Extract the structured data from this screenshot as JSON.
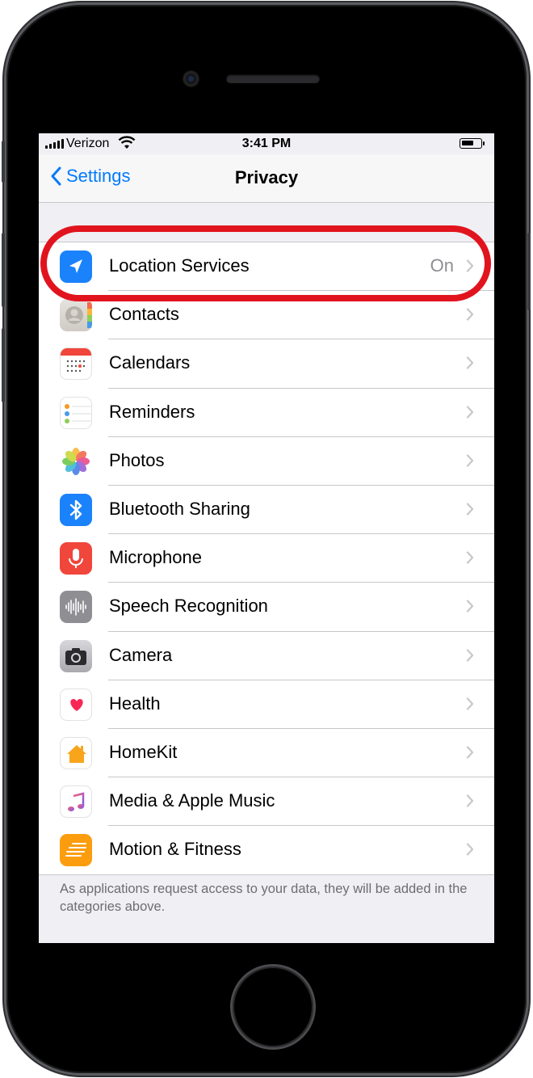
{
  "status_bar": {
    "carrier": "Verizon",
    "time": "3:41 PM"
  },
  "nav": {
    "back_label": "Settings",
    "title": "Privacy"
  },
  "rows": [
    {
      "label": "Location Services",
      "value": "On",
      "icon": "location-arrow-icon"
    },
    {
      "label": "Contacts",
      "icon": "contacts-icon"
    },
    {
      "label": "Calendars",
      "icon": "calendar-icon"
    },
    {
      "label": "Reminders",
      "icon": "reminders-icon"
    },
    {
      "label": "Photos",
      "icon": "photos-icon"
    },
    {
      "label": "Bluetooth Sharing",
      "icon": "bluetooth-icon"
    },
    {
      "label": "Microphone",
      "icon": "microphone-icon"
    },
    {
      "label": "Speech Recognition",
      "icon": "waveform-icon"
    },
    {
      "label": "Camera",
      "icon": "camera-icon"
    },
    {
      "label": "Health",
      "icon": "heart-icon"
    },
    {
      "label": "HomeKit",
      "icon": "home-icon"
    },
    {
      "label": "Media & Apple Music",
      "icon": "music-note-icon"
    },
    {
      "label": "Motion & Fitness",
      "icon": "motion-icon"
    }
  ],
  "footer_text": "As applications request access to your data, they will be added in the categories above.",
  "colors": {
    "accent": "#007aff",
    "highlight": "#e1141e",
    "background": "#efeff4"
  }
}
